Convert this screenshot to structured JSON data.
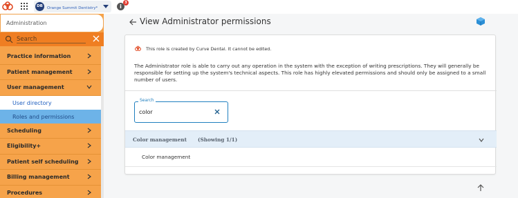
{
  "topbar": {
    "avatar_initials": "DB",
    "practice_name": "Orange Summit Dentistry*",
    "notification_count": "3"
  },
  "sidebar": {
    "header": "Administration",
    "search_label": "Search",
    "items": [
      {
        "label": "Practice information"
      },
      {
        "label": "Patient management"
      },
      {
        "label": "User management"
      },
      {
        "label": "User directory"
      },
      {
        "label": "Roles and permissions"
      },
      {
        "label": "Scheduling"
      },
      {
        "label": "Eligibility+"
      },
      {
        "label": "Patient self scheduling"
      },
      {
        "label": "Billing management"
      },
      {
        "label": "Procedures"
      }
    ]
  },
  "main": {
    "title": "View Administrator permissions",
    "note": "This role is created by Curve Dental. It cannot be edited.",
    "description": "The Administrator role is able to carry out any operation in the system with the exception of writing prescriptions. They will generally be responsible for setting up the system's technical aspects. This role has highly elevated permissions and should only be assigned to a small number of users.",
    "search": {
      "label": "Search",
      "value": "color"
    },
    "group": {
      "title": "Color management",
      "count": "(Showing 1/1)"
    },
    "permissions": [
      "Color management"
    ]
  },
  "colors": {
    "sidebar_orange": "#f6a34a",
    "search_orange": "#ef7e22",
    "active_blue": "#6db3e8",
    "accent_blue": "#1f7fbf",
    "brand_red": "#e0461f"
  }
}
